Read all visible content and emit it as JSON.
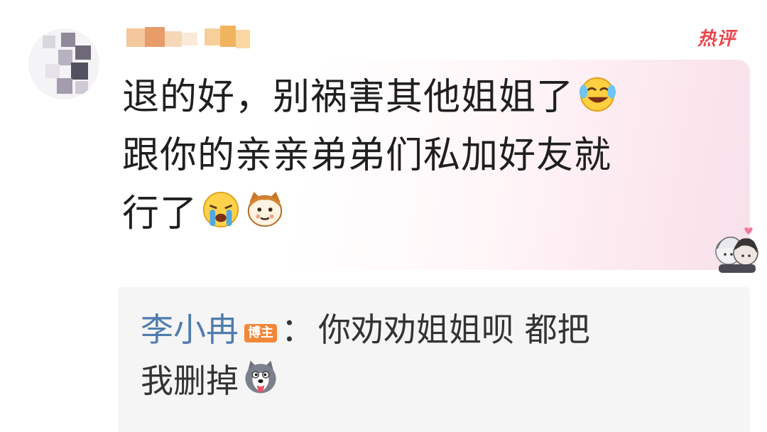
{
  "comment": {
    "username": "",
    "hot_badge": "热评",
    "line1": "退的好，别祸害其他姐姐了",
    "line2": "跟你的亲亲弟弟们私加好友就",
    "line3": "行了",
    "emojis": [
      "laugh-cry-emoji",
      "loud-cry-emoji",
      "cat-face-emoji"
    ]
  },
  "reply": {
    "author": "李小冉",
    "author_badge": "博主",
    "separator": "：",
    "text_line1": "你劝劝姐姐呗 都把",
    "text_line2": "我删掉",
    "emoji": "husky-dog-emoji"
  },
  "colors": {
    "hot": "#e8474d",
    "author_link": "#4f7cae",
    "badge": "#f2873a",
    "reply_bg": "#f5f5f5"
  }
}
